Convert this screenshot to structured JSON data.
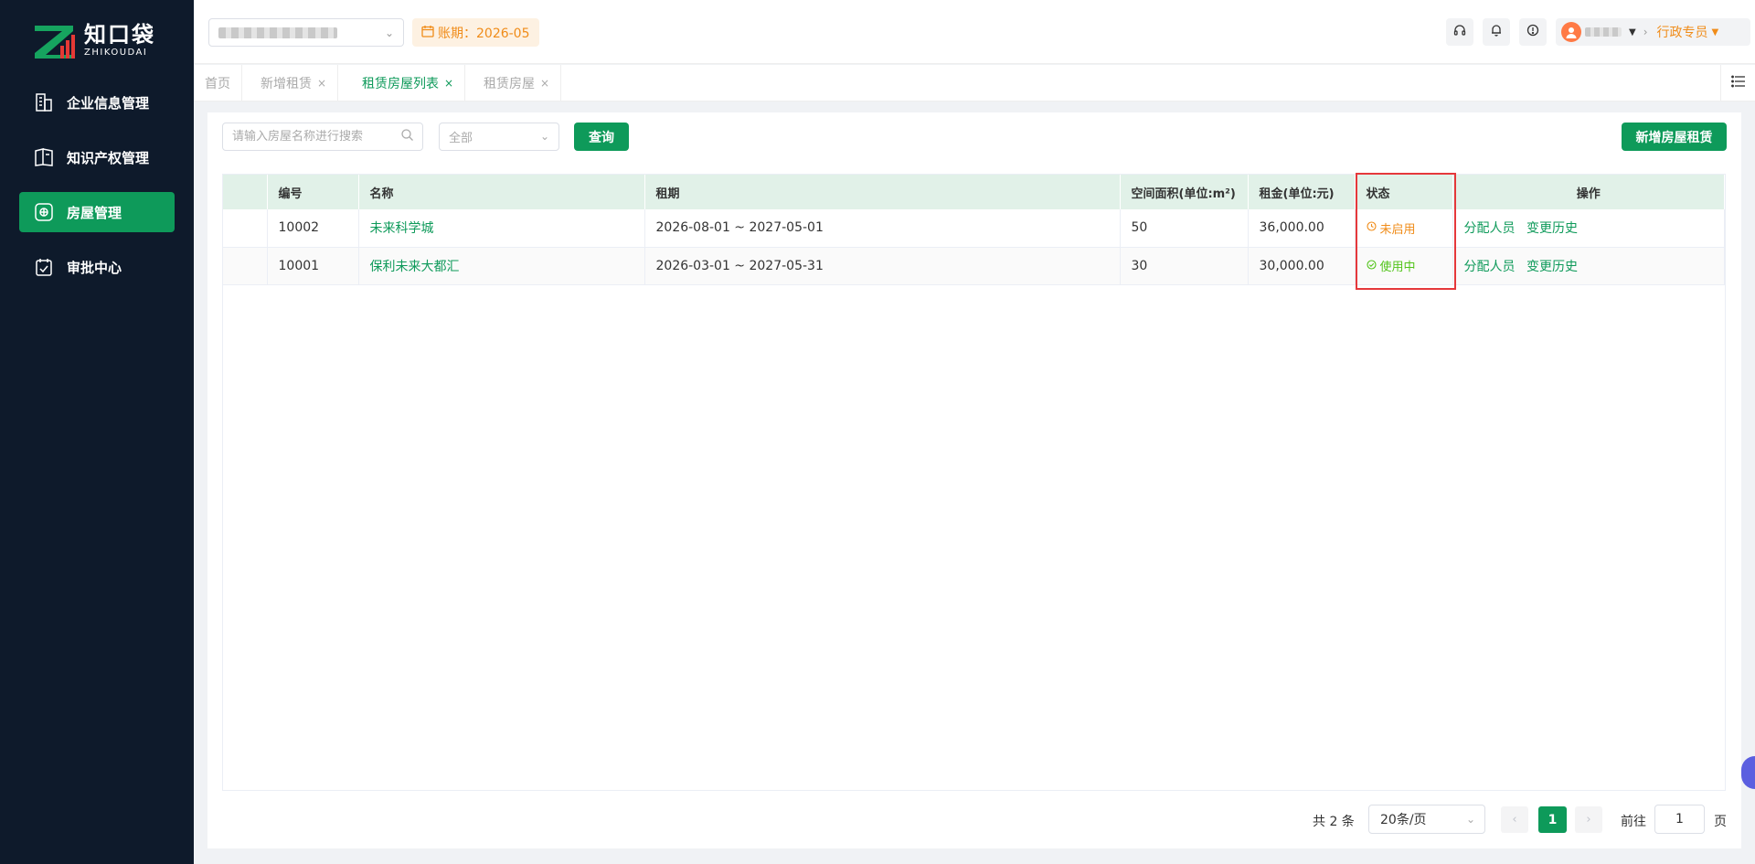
{
  "brand": {
    "name_cn": "知口袋",
    "name_en": "ZHIKOUDAI"
  },
  "sidebar": {
    "items": [
      {
        "label": "企业信息管理",
        "icon": "building-icon",
        "active": false
      },
      {
        "label": "知识产权管理",
        "icon": "book-icon",
        "active": false
      },
      {
        "label": "房屋管理",
        "icon": "house-icon",
        "active": true
      },
      {
        "label": "审批中心",
        "icon": "clipboard-icon",
        "active": false
      }
    ]
  },
  "header": {
    "period_label": "账期：2026-05",
    "role": "行政专员",
    "icons": [
      "headset-icon",
      "bell-icon",
      "alert-icon"
    ]
  },
  "tabs": [
    {
      "label": "首页",
      "closable": false,
      "active": false
    },
    {
      "label": "新增租赁",
      "closable": true,
      "active": false
    },
    {
      "label": "租赁房屋列表",
      "closable": true,
      "active": true
    },
    {
      "label": "租赁房屋",
      "closable": true,
      "active": false
    }
  ],
  "toolbar": {
    "search_placeholder": "请输入房屋名称进行搜索",
    "status_filter": "全部",
    "query_label": "查询",
    "add_label": "新增房屋租赁"
  },
  "table": {
    "columns": [
      "编号",
      "名称",
      "租期",
      "空间面积(单位:m²)",
      "租金(单位:元)",
      "状态",
      "操作"
    ],
    "rows": [
      {
        "id": "10002",
        "name": "未来科学城",
        "term": "2026-08-01 ~ 2027-05-01",
        "area": "50",
        "rent": "36,000.00",
        "status": "未启用",
        "status_color": "#f08c19"
      },
      {
        "id": "10001",
        "name": "保利未来大都汇",
        "term": "2026-03-01 ~ 2027-05-31",
        "area": "30",
        "rent": "30,000.00",
        "status": "使用中",
        "status_color": "#52c41a"
      }
    ],
    "actions": [
      "分配人员",
      "变更历史"
    ]
  },
  "pagination": {
    "total": "共 2 条",
    "page_size": "20条/页",
    "current_page": "1",
    "goto_label": "前往",
    "goto_value": "1",
    "page_unit": "页"
  },
  "colors": {
    "accent": "#0e9a5a",
    "sidebar_bg": "#0e1a2b",
    "warning": "#f08c19",
    "highlight": "#e5383b"
  }
}
